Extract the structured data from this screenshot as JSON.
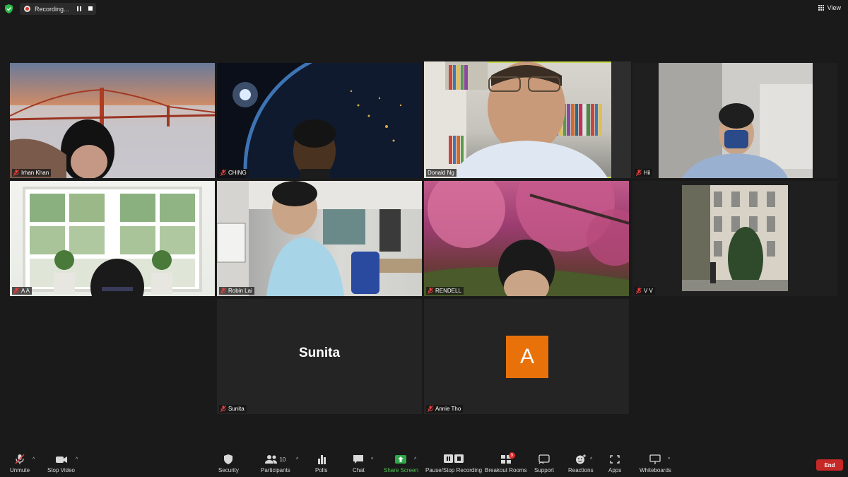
{
  "topbar": {
    "recording_label": "Recording...",
    "view_label": "View"
  },
  "participants": [
    {
      "name": "Irhan Khan",
      "muted": true
    },
    {
      "name": "CHING",
      "muted": true
    },
    {
      "name": "Donald Ng",
      "muted": false,
      "active_speaker": true
    },
    {
      "name": "Hii",
      "muted": true
    },
    {
      "name": "A A",
      "muted": true
    },
    {
      "name": "Robin Lai",
      "muted": true
    },
    {
      "name": "RENDELL",
      "muted": true
    },
    {
      "name": "V V",
      "muted": true
    },
    {
      "name": "Sunita",
      "muted": true,
      "display_name": "Sunita"
    },
    {
      "name": "Annie Tho",
      "muted": true,
      "avatar_letter": "A"
    }
  ],
  "toolbar": {
    "unmute": "Unmute",
    "stop_video": "Stop Video",
    "security": "Security",
    "participants": "Participants",
    "participants_count": "10",
    "polls": "Polls",
    "chat": "Chat",
    "share_screen": "Share Screen",
    "pause_stop_recording": "Pause/Stop Recording",
    "breakout_rooms": "Breakout Rooms",
    "breakout_badge": "9",
    "support": "Support",
    "reactions": "Reactions",
    "apps": "Apps",
    "whiteboards": "Whiteboards",
    "end": "End"
  },
  "colors": {
    "active_speaker_border": "#c4d94a",
    "share_green": "#4fc34f",
    "end_red": "#c62828",
    "avatar_orange": "#e8710a"
  }
}
